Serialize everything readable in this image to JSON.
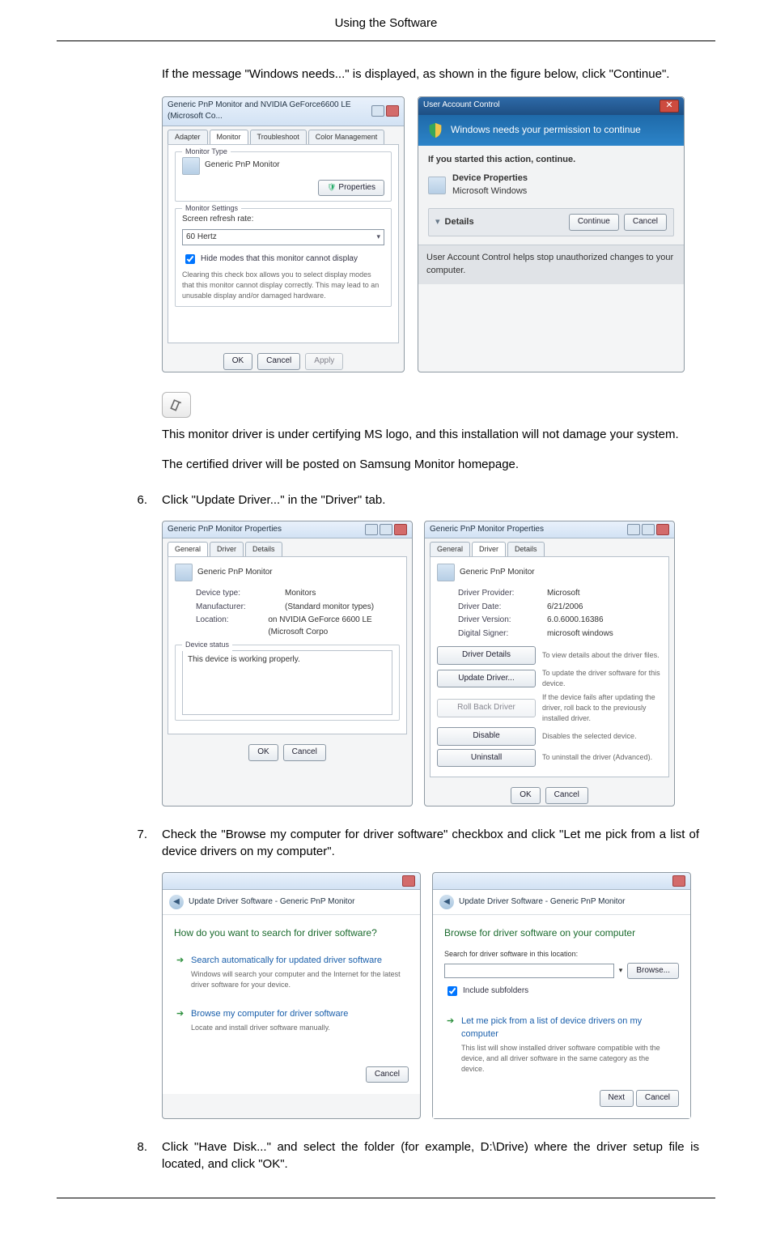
{
  "header": {
    "title": "Using the Software"
  },
  "intro": "If the message \"Windows needs...\" is displayed, as shown in the figure below, click \"Continue\".",
  "fig1_props": {
    "title": "Generic PnP Monitor and NVIDIA GeForce6600 LE (Microsoft Co...",
    "tabs": [
      "Adapter",
      "Monitor",
      "Troubleshoot",
      "Color Management"
    ],
    "monitor_type_label": "Monitor Type",
    "monitor_name": "Generic PnP Monitor",
    "properties_btn": "Properties",
    "settings_label": "Monitor Settings",
    "refresh_label": "Screen refresh rate:",
    "refresh_value": "60 Hertz",
    "hide_label": "Hide modes that this monitor cannot display",
    "hide_note": "Clearing this check box allows you to select display modes that this monitor cannot display correctly. This may lead to an unusable display and/or damaged hardware.",
    "ok": "OK",
    "cancel": "Cancel",
    "apply": "Apply"
  },
  "uac": {
    "title": "User Account Control",
    "band": "Windows needs your permission to continue",
    "started": "If you started this action, continue.",
    "dev_l1": "Device Properties",
    "dev_l2": "Microsoft Windows",
    "details": "Details",
    "continue": "Continue",
    "cancel": "Cancel",
    "foot": "User Account Control helps stop unauthorized changes to your computer."
  },
  "mid_p1": "This monitor driver is under certifying MS logo, and this installation will not damage your system.",
  "mid_p2": "The certified driver will be posted on Samsung Monitor homepage.",
  "step6": {
    "n": "6.",
    "text": "Click \"Update Driver...\" in the \"Driver\" tab."
  },
  "props_general": {
    "title": "Generic PnP Monitor Properties",
    "tabs": [
      "General",
      "Driver",
      "Details"
    ],
    "name": "Generic PnP Monitor",
    "rows": {
      "type_k": "Device type:",
      "type_v": "Monitors",
      "manu_k": "Manufacturer:",
      "manu_v": "(Standard monitor types)",
      "loc_k": "Location:",
      "loc_v": "on NVIDIA GeForce 6600 LE (Microsoft Corpo"
    },
    "status_label": "Device status",
    "status_text": "This device is working properly.",
    "ok": "OK",
    "cancel": "Cancel"
  },
  "props_driver": {
    "title": "Generic PnP Monitor Properties",
    "tabs": [
      "General",
      "Driver",
      "Details"
    ],
    "name": "Generic PnP Monitor",
    "rows": {
      "prov_k": "Driver Provider:",
      "prov_v": "Microsoft",
      "date_k": "Driver Date:",
      "date_v": "6/21/2006",
      "ver_k": "Driver Version:",
      "ver_v": "6.0.6000.16386",
      "sign_k": "Digital Signer:",
      "sign_v": "microsoft windows"
    },
    "btns": {
      "details": "Driver Details",
      "details_d": "To view details about the driver files.",
      "update": "Update Driver...",
      "update_d": "To update the driver software for this device.",
      "roll": "Roll Back Driver",
      "roll_d": "If the device fails after updating the driver, roll back to the previously installed driver.",
      "disable": "Disable",
      "disable_d": "Disables the selected device.",
      "uninstall": "Uninstall",
      "uninstall_d": "To uninstall the driver (Advanced)."
    },
    "ok": "OK",
    "cancel": "Cancel"
  },
  "step7": {
    "n": "7.",
    "text": "Check the \"Browse my computer for driver software\" checkbox and click \"Let me pick from a list of device drivers on my computer\"."
  },
  "wiz1": {
    "crumb": "Update Driver Software - Generic PnP Monitor",
    "h": "How do you want to search for driver software?",
    "opt1_t": "Search automatically for updated driver software",
    "opt1_d": "Windows will search your computer and the Internet for the latest driver software for your device.",
    "opt2_t": "Browse my computer for driver software",
    "opt2_d": "Locate and install driver software manually.",
    "cancel": "Cancel"
  },
  "wiz2": {
    "crumb": "Update Driver Software - Generic PnP Monitor",
    "h": "Browse for driver software on your computer",
    "search_l": "Search for driver software in this location:",
    "browse": "Browse...",
    "include": "Include subfolders",
    "opt_t": "Let me pick from a list of device drivers on my computer",
    "opt_d": "This list will show installed driver software compatible with the device, and all driver software in the same category as the device.",
    "next": "Next",
    "cancel": "Cancel"
  },
  "step8": {
    "n": "8.",
    "text": "Click \"Have Disk...\" and select the folder (for example, D:\\Drive) where the driver setup file is located, and click \"OK\"."
  }
}
